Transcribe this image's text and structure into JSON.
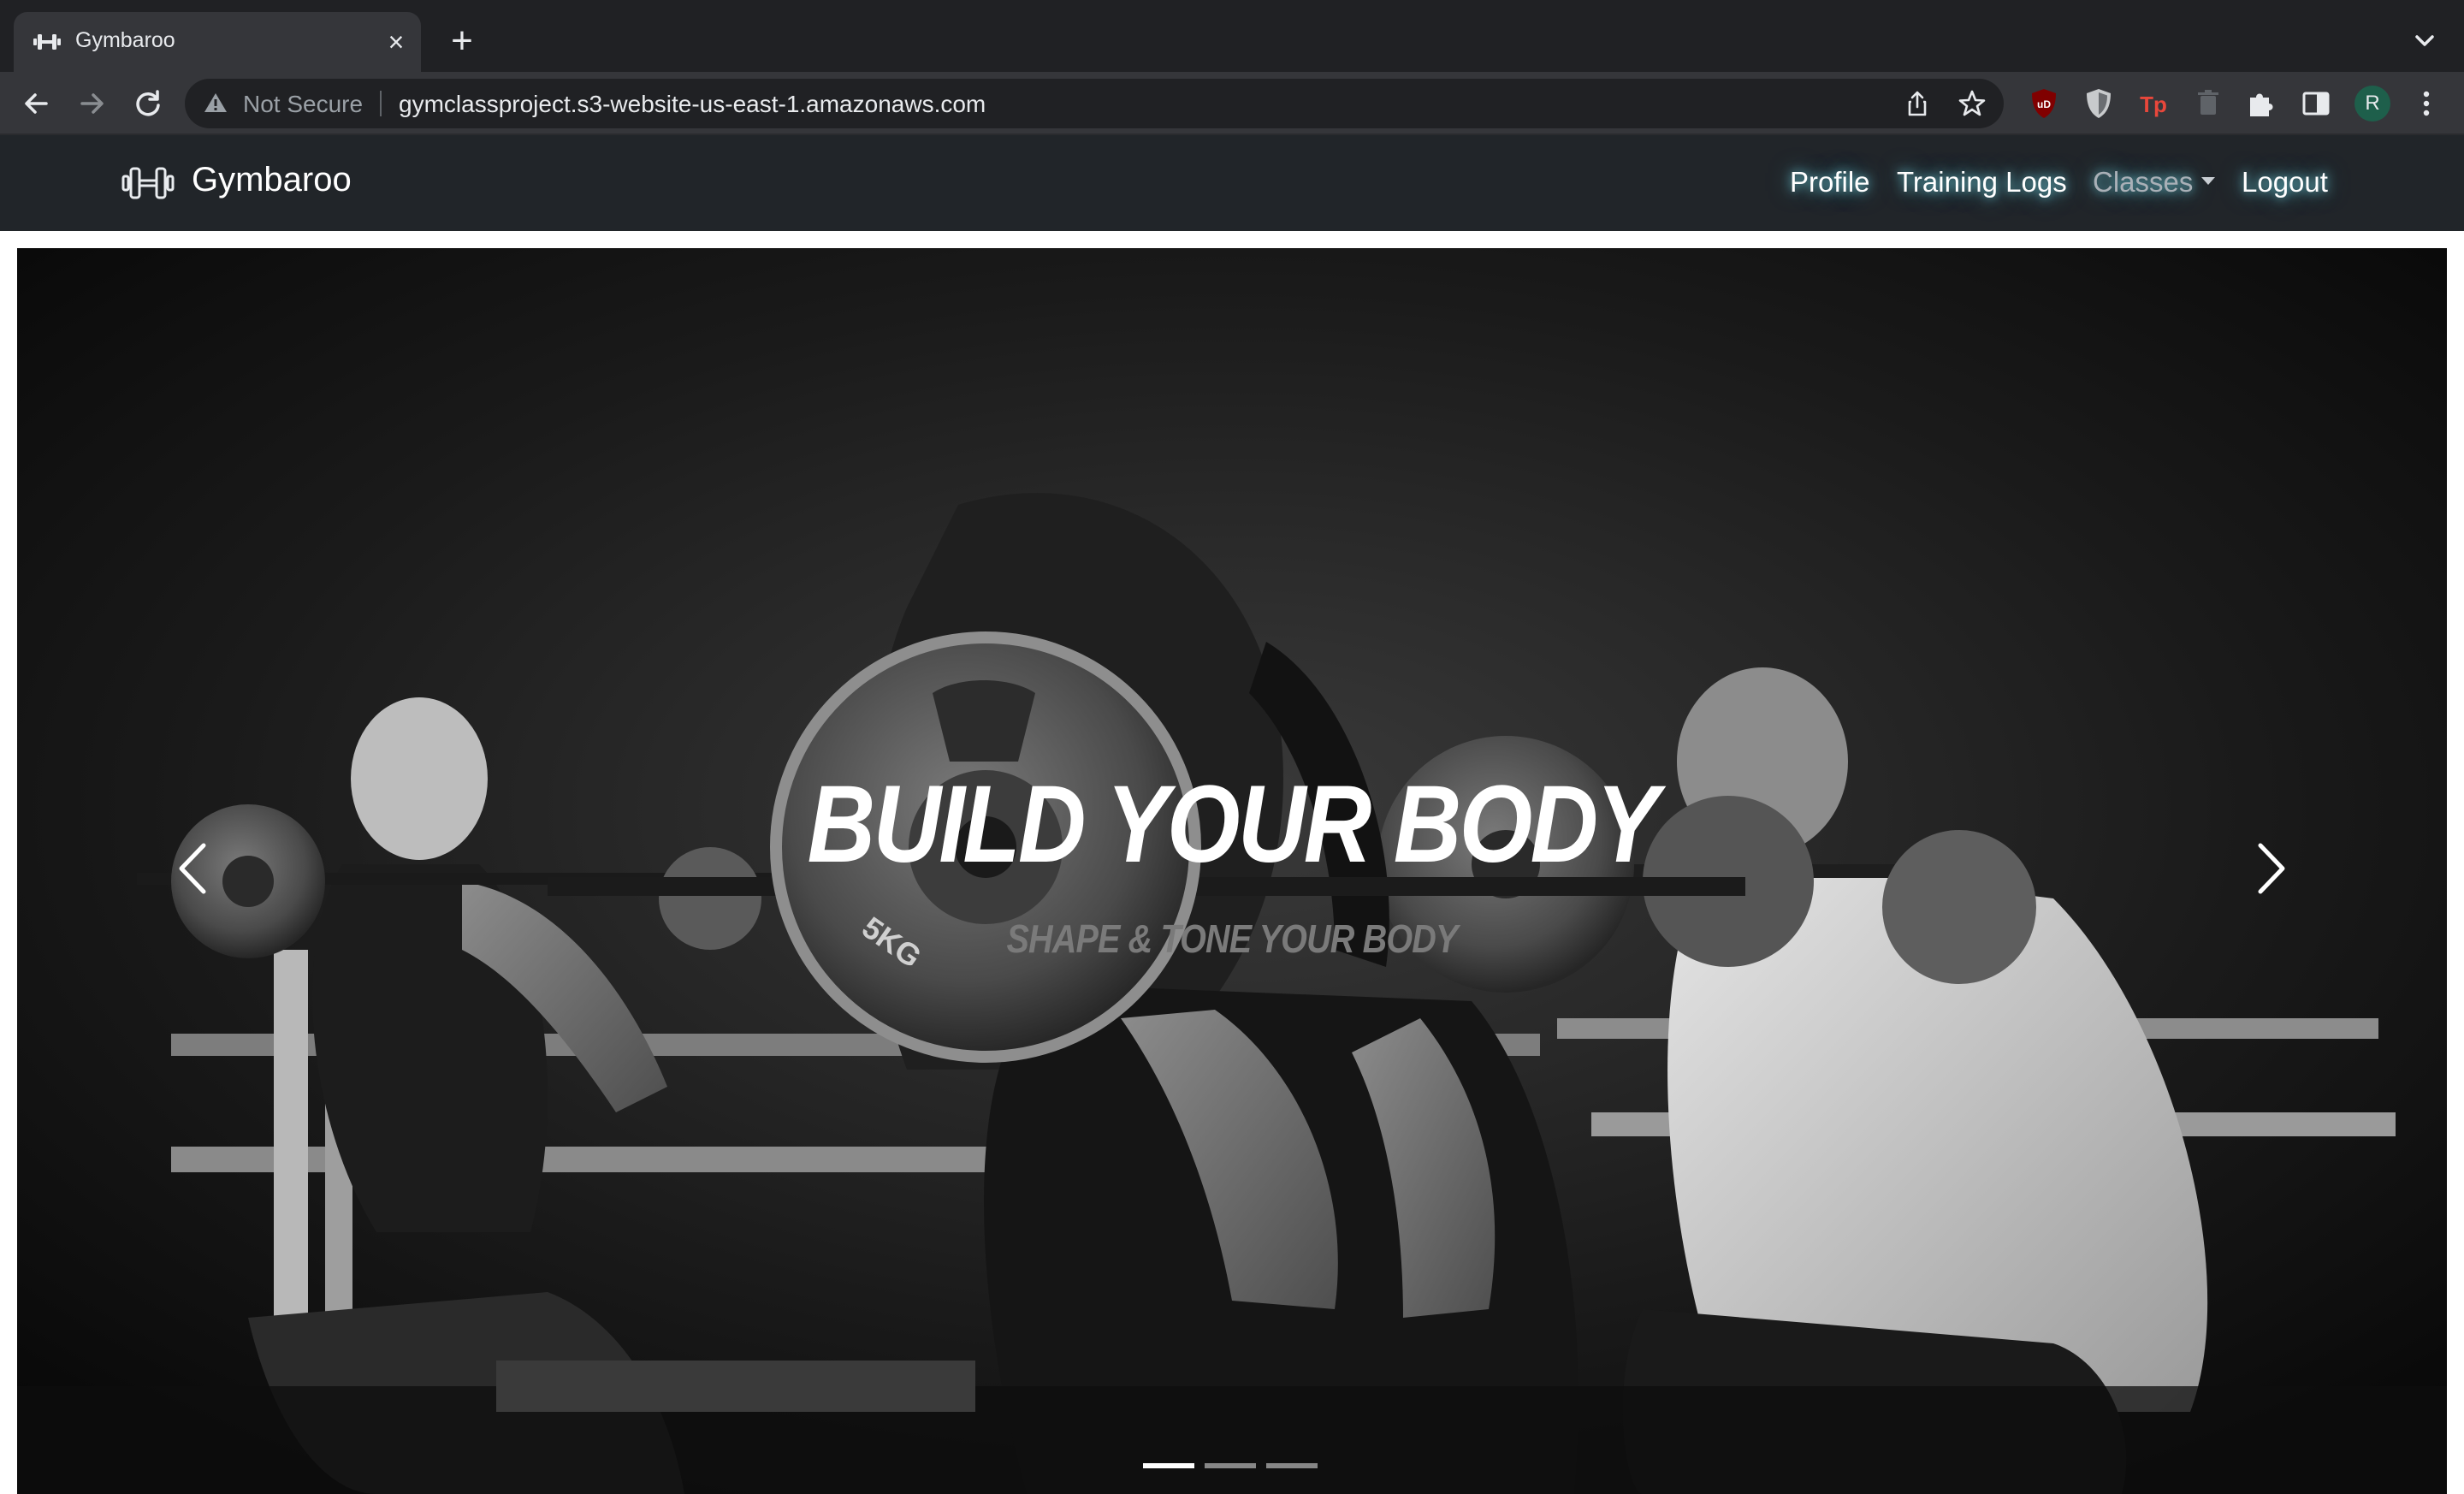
{
  "browser": {
    "tab": {
      "title": "Gymbaroo"
    },
    "omnibox": {
      "security_label": "Not Secure",
      "url": "gymclassproject.s3-website-us-east-1.amazonaws.com"
    },
    "profile_initial": "R"
  },
  "site": {
    "brand": "Gymbaroo",
    "nav": {
      "profile": "Profile",
      "training_logs": "Training Logs",
      "classes": "Classes",
      "logout": "Logout"
    },
    "nav_glow_color": "#6fd6e6"
  },
  "hero": {
    "slides": [
      {
        "title": "BUILD YOUR BODY",
        "subtitle": "SHAPE & TONE YOUR BODY"
      }
    ],
    "indicator_count": 3,
    "active_indicator": 1
  }
}
